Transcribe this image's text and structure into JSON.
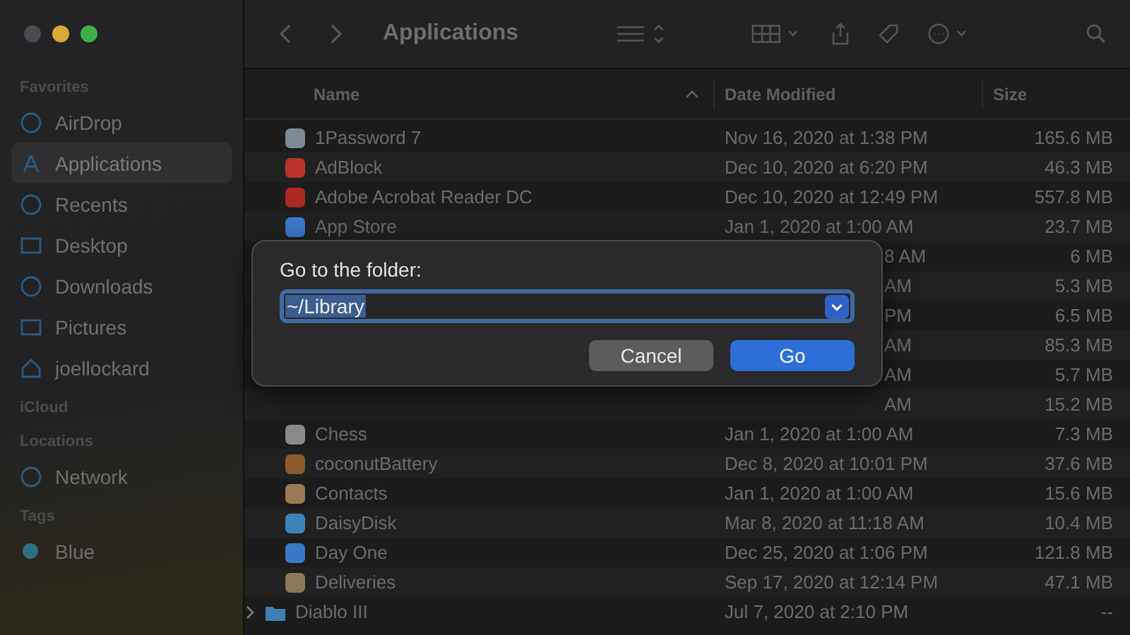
{
  "window": {
    "title": "Applications"
  },
  "sidebar": {
    "sections": [
      {
        "header": "Favorites",
        "items": [
          {
            "label": "AirDrop",
            "selected": false
          },
          {
            "label": "Applications",
            "selected": true
          },
          {
            "label": "Recents",
            "selected": false
          },
          {
            "label": "Desktop",
            "selected": false
          },
          {
            "label": "Downloads",
            "selected": false
          },
          {
            "label": "Pictures",
            "selected": false
          },
          {
            "label": "joellockard",
            "selected": false
          }
        ]
      },
      {
        "header": "iCloud"
      },
      {
        "header": "Locations",
        "items": [
          {
            "label": "Network",
            "selected": false
          }
        ]
      },
      {
        "header": "Tags",
        "items": [
          {
            "label": "Blue",
            "selected": false,
            "color": "#2d6f86"
          }
        ]
      }
    ]
  },
  "table": {
    "columns": [
      {
        "label": "Name",
        "sorted": true
      },
      {
        "label": "Date Modified",
        "sorted": false
      },
      {
        "label": "Size",
        "sorted": false
      }
    ],
    "rows": [
      {
        "kind": "app",
        "name": "1Password 7",
        "date": "Nov 16, 2020 at 1:38 PM",
        "size": "165.6 MB"
      },
      {
        "kind": "app",
        "name": "AdBlock",
        "date": "Dec 10, 2020 at 6:20 PM",
        "size": "46.3 MB"
      },
      {
        "kind": "app",
        "name": "Adobe Acrobat Reader DC",
        "date": "Dec 10, 2020 at 12:49 PM",
        "size": "557.8 MB"
      },
      {
        "kind": "app",
        "name": "App Store",
        "date": "Jan 1, 2020 at 1:00 AM",
        "size": "23.7 MB"
      },
      {
        "kind": "covered",
        "date": "8 AM",
        "size": "6 MB"
      },
      {
        "kind": "covered",
        "date": "AM",
        "size": "5.3 MB"
      },
      {
        "kind": "covered",
        "date": "PM",
        "size": "6.5 MB"
      },
      {
        "kind": "covered",
        "date": "AM",
        "size": "85.3 MB"
      },
      {
        "kind": "covered",
        "date": "AM",
        "size": "5.7 MB"
      },
      {
        "kind": "covered",
        "date": "AM",
        "size": "15.2 MB"
      },
      {
        "kind": "app",
        "name": "Chess",
        "date": "Jan 1, 2020 at 1:00 AM",
        "size": "7.3 MB"
      },
      {
        "kind": "app",
        "name": "coconutBattery",
        "date": "Dec 8, 2020 at 10:01 PM",
        "size": "37.6 MB"
      },
      {
        "kind": "app",
        "name": "Contacts",
        "date": "Jan 1, 2020 at 1:00 AM",
        "size": "15.6 MB"
      },
      {
        "kind": "app",
        "name": "DaisyDisk",
        "date": "Mar 8, 2020 at 11:18 AM",
        "size": "10.4 MB"
      },
      {
        "kind": "app",
        "name": "Day One",
        "date": "Dec 25, 2020 at 1:06 PM",
        "size": "121.8 MB"
      },
      {
        "kind": "app",
        "name": "Deliveries",
        "date": "Sep 17, 2020 at 12:14 PM",
        "size": "47.1 MB"
      },
      {
        "kind": "folder",
        "name": "Diablo III",
        "expanded": false,
        "date": "Jul 7, 2020 at 2:10 PM",
        "size": "--"
      }
    ]
  },
  "dialog": {
    "label": "Go to the folder:",
    "value": "~/Library",
    "value_selected": true,
    "buttons": [
      {
        "label": "Cancel",
        "default": false
      },
      {
        "label": "Go",
        "default": true
      }
    ]
  }
}
